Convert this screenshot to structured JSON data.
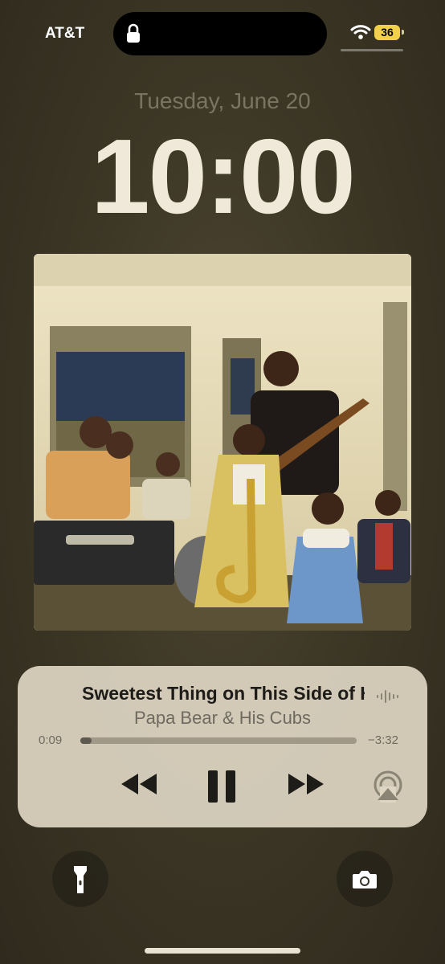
{
  "status_bar": {
    "carrier": "AT&T",
    "battery_level": "36",
    "icons": [
      "lock-icon",
      "wifi-icon",
      "battery-icon"
    ]
  },
  "lock_screen": {
    "date": "Tuesday, June 20",
    "time": "10:00"
  },
  "now_playing": {
    "title": "Sweetest Thing on This Side of Heaven",
    "artist": "Papa Bear & His Cubs",
    "elapsed": "0:09",
    "remaining": "−3:32",
    "progress_fraction": 0.04,
    "controls": [
      "rewind-icon",
      "pause-icon",
      "forward-icon",
      "airplay-icon"
    ]
  },
  "quick_actions": [
    "flashlight-icon",
    "camera-icon"
  ],
  "colors": {
    "battery": "#f2d14a",
    "clock": "#f0e8d8",
    "player_bg": "#ded6c3"
  }
}
